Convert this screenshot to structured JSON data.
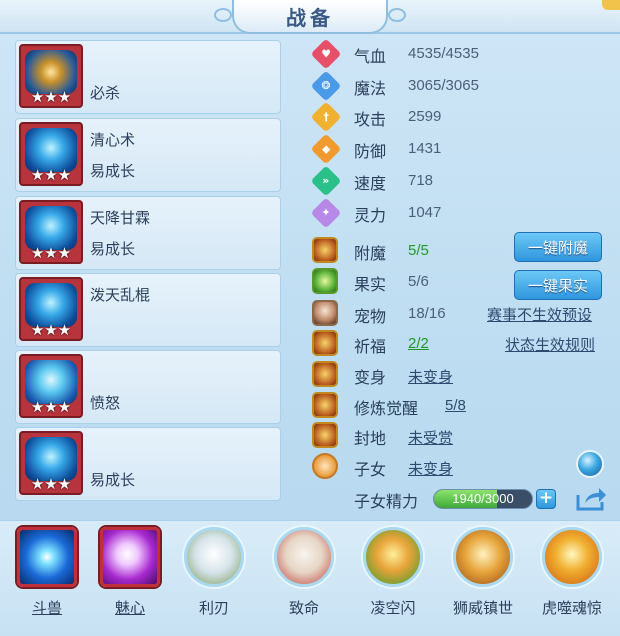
{
  "title": "战备",
  "skills": [
    {
      "name": "",
      "desc": "必杀",
      "stars": "★★★"
    },
    {
      "name": "清心术",
      "desc": "易成长",
      "stars": "★★★"
    },
    {
      "name": "天降甘霖",
      "desc": "易成长",
      "stars": "★★★"
    },
    {
      "name": "泼天乱棍",
      "desc": "",
      "stars": "★★★"
    },
    {
      "name": "",
      "desc": "愤怒",
      "stars": "★★★"
    },
    {
      "name": "",
      "desc": "易成长",
      "stars": "★★★"
    }
  ],
  "stats": [
    {
      "label": "气血",
      "value": "4535/4535",
      "icon": "heart-icon",
      "color": "#e8506a",
      "glyph": "♥"
    },
    {
      "label": "魔法",
      "value": "3065/3065",
      "icon": "magic-icon",
      "color": "#4a9ae8",
      "glyph": "❂"
    },
    {
      "label": "攻击",
      "value": "2599",
      "icon": "sword-icon",
      "color": "#f0b030",
      "glyph": "†"
    },
    {
      "label": "防御",
      "value": "1431",
      "icon": "shield-icon",
      "color": "#f09a30",
      "glyph": "◆"
    },
    {
      "label": "速度",
      "value": "718",
      "icon": "speed-icon",
      "color": "#2ac08a",
      "glyph": "»"
    },
    {
      "label": "灵力",
      "value": "1047",
      "icon": "spirit-icon",
      "color": "#b888e8",
      "glyph": "✦"
    }
  ],
  "attrs": {
    "enchant": {
      "label": "附魔",
      "value": "5/5",
      "button": "一键附魔"
    },
    "fruit": {
      "label": "果实",
      "value": "5/6",
      "button": "一键果实"
    },
    "pet": {
      "label": "宠物",
      "value": "18/16",
      "link": "赛事不生效预设"
    },
    "blessing": {
      "label": "祈福",
      "value": "2/2",
      "link": "状态生效规则"
    },
    "transform": {
      "label": "变身",
      "value": "未变身"
    },
    "awaken": {
      "label": "修炼觉醒",
      "value": "5/8"
    },
    "fief": {
      "label": "封地",
      "value": "未受赏"
    },
    "child": {
      "label": "子女",
      "value": "未变身"
    },
    "child_vigor": {
      "label": "子女精力",
      "value": "1940/3000",
      "fraction": 0.647
    }
  },
  "bottom_skills": [
    {
      "label": "斗兽"
    },
    {
      "label": "魅心"
    },
    {
      "label": "利刃"
    },
    {
      "label": "致命"
    },
    {
      "label": "凌空闪"
    },
    {
      "label": "狮威镇世"
    },
    {
      "label": "虎噬魂惊"
    }
  ]
}
